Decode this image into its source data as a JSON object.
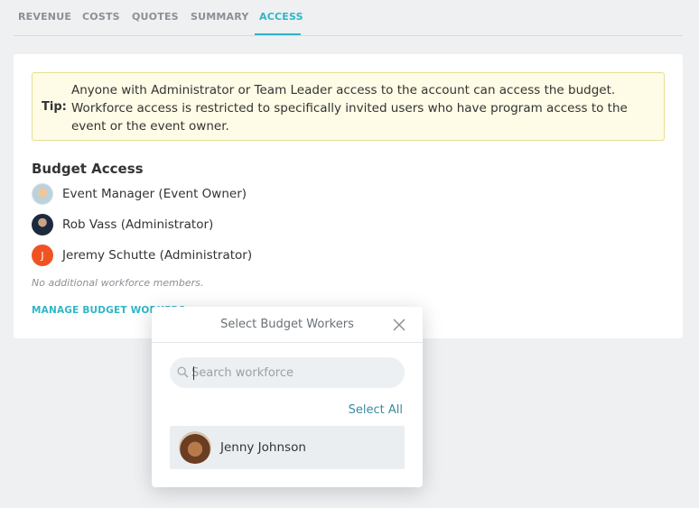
{
  "tabs": [
    {
      "label": "REVENUE",
      "active": false
    },
    {
      "label": "COSTS",
      "active": false
    },
    {
      "label": "QUOTES",
      "active": false
    },
    {
      "label": "SUMMARY",
      "active": false
    },
    {
      "label": "ACCESS",
      "active": true
    }
  ],
  "tip": {
    "label": "Tip:",
    "text": "Anyone with Administrator or Team Leader access to the account can access the budget. Workforce access is restricted to specifically invited users who have program access to the event or the event owner."
  },
  "budget_access": {
    "title": "Budget Access",
    "members": [
      {
        "name": "Event Manager (Event Owner)",
        "avatar": "photo"
      },
      {
        "name": "Rob Vass (Administrator)",
        "avatar": "photo"
      },
      {
        "name": "Jeremy Schutte (Administrator)",
        "avatar_initial": "J"
      }
    ],
    "no_additional": "No additional workforce members.",
    "manage_link": "MANAGE BUDGET WORKERS"
  },
  "modal": {
    "title": "Select Budget Workers",
    "search_placeholder": "Search workforce",
    "select_all": "Select All",
    "workers": [
      {
        "name": "Jenny Johnson"
      }
    ]
  },
  "colors": {
    "accent": "#2fb6c6",
    "tip_background": "#fefbe6",
    "tip_border": "#e6e093",
    "initial_avatar": "#f05323"
  }
}
